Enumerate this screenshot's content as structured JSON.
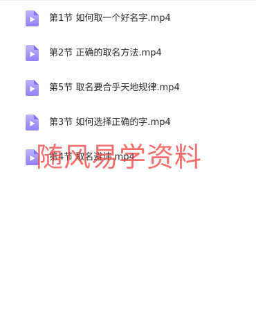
{
  "files": [
    {
      "name": "第1节 如何取一个好名字.mp4",
      "icon": "video-file-icon"
    },
    {
      "name": "第2节 正确的取名方法.mp4",
      "icon": "video-file-icon"
    },
    {
      "name": "第5节 取名要合乎天地规律.mp4",
      "icon": "video-file-icon"
    },
    {
      "name": "第3节 如何选择正确的字.mp4",
      "icon": "video-file-icon"
    },
    {
      "name": "第4节 取名避讳.mp4",
      "icon": "video-file-icon"
    }
  ],
  "watermark": "随风易学资料",
  "colors": {
    "icon_light": "#b9b0fb",
    "icon_dark": "#7d6ff2",
    "text": "#2b2b2b",
    "watermark": "#ee4646"
  }
}
